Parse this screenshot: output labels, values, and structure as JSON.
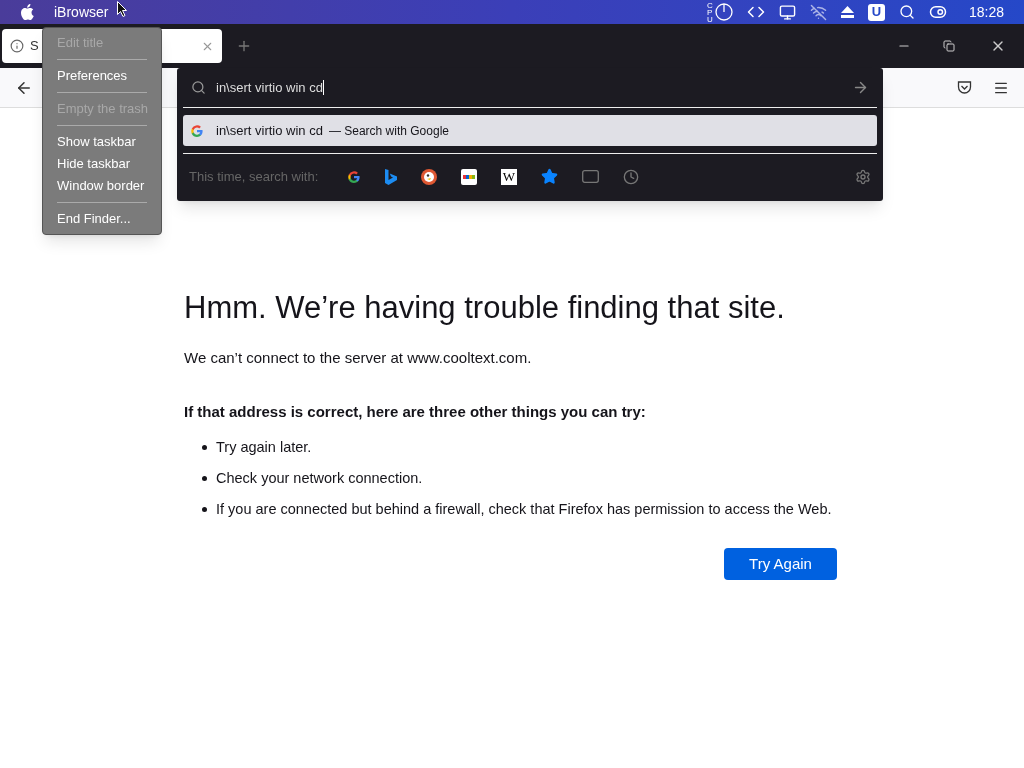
{
  "menubar": {
    "app_name": "iBrowser",
    "cpu_label": "CPU",
    "user_badge": "U",
    "clock": "18:28"
  },
  "app_menu": {
    "items": [
      {
        "kind": "item",
        "label": "Edit title",
        "disabled": true
      },
      {
        "kind": "separator"
      },
      {
        "kind": "item",
        "label": "Preferences",
        "disabled": false
      },
      {
        "kind": "separator"
      },
      {
        "kind": "item",
        "label": "Empty the trash",
        "disabled": true
      },
      {
        "kind": "separator"
      },
      {
        "kind": "item",
        "label": "Show taskbar",
        "disabled": false
      },
      {
        "kind": "item",
        "label": "Hide taskbar",
        "disabled": false
      },
      {
        "kind": "item",
        "label": "Window border",
        "disabled": false
      },
      {
        "kind": "separator"
      },
      {
        "kind": "item",
        "label": "End Finder...",
        "disabled": false
      }
    ]
  },
  "tabs": [
    {
      "title": "S",
      "selected": true
    }
  ],
  "url_popup": {
    "query": "in\\sert virtio win cd",
    "suggestion": {
      "text": "in\\sert virtio win cd",
      "action": "— Search with Google",
      "selected": true
    },
    "one_off_label": "This time, search with:",
    "wikipedia_letter": "W"
  },
  "error_page": {
    "title": "Hmm. We’re having trouble finding that site.",
    "message": "We can’t connect to the server at www.cooltext.com.",
    "subtitle": "If that address is correct, here are three other things you can try:",
    "tips": [
      "Try again later.",
      "Check your network connection.",
      "If you are connected but behind a firewall, check that Firefox has permission to access the Web."
    ],
    "button": "Try Again"
  }
}
